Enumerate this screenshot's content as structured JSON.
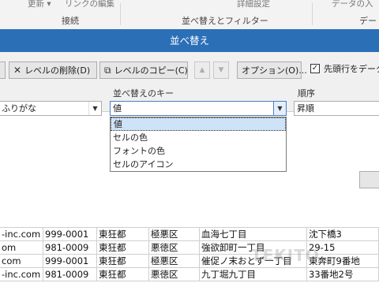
{
  "ribbon": {
    "refresh_label": "更新 ▾",
    "edit_links_label": "リンクの編集",
    "advanced_label": "詳細設定",
    "data_input_label": "データの入",
    "group_connections": "接続",
    "group_sort_filter": "並べ替えとフィルター",
    "group_data": "デー"
  },
  "dialog": {
    "title": "並べ替え",
    "delete_level_label": "レベルの削除(D)",
    "copy_level_label": "レベルのコピー(C)",
    "options_label": "オプション(O)...",
    "header_checkbox_label": "先頭行をデータ",
    "header_checkbox_checked": true,
    "col_header_sortkey": "並べ替えのキー",
    "col_header_order": "順序",
    "column_value": "ふりがな",
    "sortkey_value": "値",
    "order_value": "昇順",
    "sortkey_options": [
      "値",
      "セルの色",
      "フォントの色",
      "セルのアイコン"
    ],
    "selected_option_index": 0
  },
  "sheet": {
    "rows": [
      [
        "-inc.com",
        "999-0001",
        "東狂都",
        "極悪区",
        "血海七丁目",
        "沈下橋3"
      ],
      [
        "om",
        "981-0009",
        "東狂都",
        "悪徳区",
        "強欲卸町一丁目",
        "29-15"
      ],
      [
        "com",
        "999-0001",
        "東狂都",
        "極悪区",
        "催促ノ末おとず一丁目",
        "東奔町9番地"
      ],
      [
        "-inc.com",
        "981-0009",
        "東狂都",
        "悪徳区",
        "九丁堀九丁目",
        "33番地2号"
      ]
    ]
  },
  "watermark": "TEKITO"
}
